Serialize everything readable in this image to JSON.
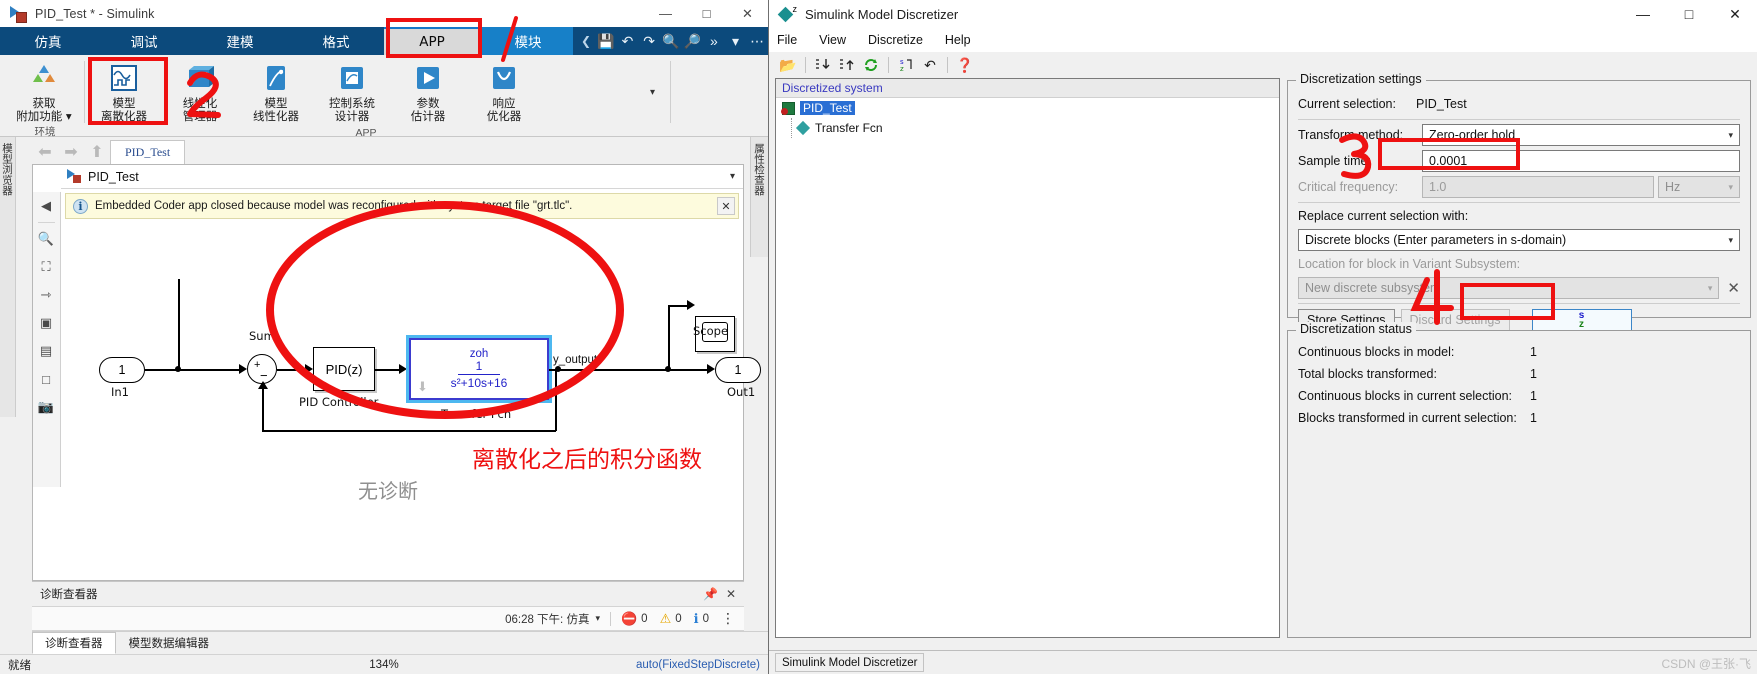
{
  "simulink": {
    "title": "PID_Test * - Simulink",
    "window_controls": {
      "minimize": "—",
      "maximize": "□",
      "close": "✕"
    },
    "ribbon_tabs": [
      {
        "label": "仿真",
        "active": false
      },
      {
        "label": "调试",
        "active": false
      },
      {
        "label": "建模",
        "active": false
      },
      {
        "label": "格式",
        "active": false
      },
      {
        "label": "APP",
        "active": true
      },
      {
        "label": "模块",
        "active": false
      }
    ],
    "quick_access": [
      "save-icon",
      "undo-icon",
      "redo-icon",
      "search-icon",
      "zoom-fit-icon",
      "more-icon",
      "chevron-down-icon",
      "ellipsis-icon"
    ],
    "ribbon_groups": [
      {
        "name": "环境",
        "items": [
          {
            "label_top": "获取",
            "label_bottom": "附加功能 ▾",
            "icon": "add-ons-icon"
          }
        ]
      },
      {
        "name": "APP",
        "items": [
          {
            "label_top": "模型",
            "label_bottom": "离散化器",
            "icon": "model-discretizer-icon"
          },
          {
            "label_top": "线性化",
            "label_bottom": "管理器",
            "icon": "linearization-manager-icon"
          },
          {
            "label_top": "模型",
            "label_bottom": "线性化器",
            "icon": "model-linearizer-icon"
          },
          {
            "label_top": "控制系统",
            "label_bottom": "设计器",
            "icon": "control-system-designer-icon"
          },
          {
            "label_top": "参数",
            "label_bottom": "估计器",
            "icon": "parameter-estimator-icon"
          },
          {
            "label_top": "响应",
            "label_bottom": "优化器",
            "icon": "response-optimizer-icon"
          }
        ]
      }
    ],
    "ribbon_expand": "▾",
    "left_vertical_tab": "模型浏览器",
    "right_vertical_tab": "属性检查器",
    "model_tab": "PID_Test",
    "nav_icons": [
      "back-arrow-icon",
      "forward-arrow-icon",
      "up-arrow-icon"
    ],
    "breadcrumb": "PID_Test",
    "notification": {
      "text": "Embedded Coder app closed because model was reconfigured with system target file \"grt.tlc\".",
      "close": "✕"
    },
    "canvas_tools": [
      "navigate-back-icon",
      "zoom-region-icon",
      "fit-to-view-icon",
      "signal-routing-icon",
      "annotation-icon",
      "scope-preview-icon",
      "area-icon",
      "camera-icon"
    ],
    "diagram": {
      "blocks": [
        {
          "name": "In1",
          "label": "In1",
          "text": "1"
        },
        {
          "name": "Sum",
          "label": "Sum",
          "plus": "+",
          "minus": "−"
        },
        {
          "name": "PID Controller",
          "label": "PID Controller",
          "text": "PID(z)"
        },
        {
          "name": "Transfer Fcn",
          "label": "Transfer Fcn",
          "zoh": "zoh",
          "num": "1",
          "den": "s²+10s+16"
        },
        {
          "name": "Scope",
          "label": "Scope"
        },
        {
          "name": "Out1",
          "label": "Out1",
          "text": "1"
        }
      ],
      "signal_label": "y_output"
    },
    "no_diagnostics": "无诊断",
    "diagnostic_panel_title": "诊断查看器",
    "diagnostic_status": {
      "timestamp": "06:28 下午: 仿真",
      "caret": "▾",
      "errors": "0",
      "warnings": "0",
      "infos": "0",
      "kebab": "⋮"
    },
    "bottom_tabs": [
      {
        "label": "诊断查看器",
        "active": true
      },
      {
        "label": "模型数据编辑器",
        "active": false
      }
    ],
    "statusbar": {
      "ready": "就绪",
      "zoom": "134%",
      "solver": "auto(FixedStepDiscrete)"
    }
  },
  "discretizer": {
    "title": "Simulink Model Discretizer",
    "window_controls": {
      "minimize": "—",
      "maximize": "□",
      "close": "✕"
    },
    "menus": [
      "File",
      "View",
      "Discretize",
      "Help"
    ],
    "toolbar_icons": [
      "open-folder-icon",
      "expand-tree-icon",
      "collapse-tree-icon",
      "refresh-icon",
      "discretize-sz-icon",
      "undo-icon",
      "help-icon"
    ],
    "tree": {
      "header": "Discretized system",
      "root": {
        "label": "PID_Test",
        "selected": true
      },
      "children": [
        {
          "label": "Transfer Fcn"
        }
      ]
    },
    "settings": {
      "legend": "Discretization settings",
      "current_selection_label": "Current selection:",
      "current_selection_value": "PID_Test",
      "transform_method_label": "Transform method:",
      "transform_method_value": "Zero-order hold",
      "sample_time_label": "Sample time:",
      "sample_time_value": "0.0001",
      "critical_frequency_label": "Critical frequency:",
      "critical_frequency_value": "1.0",
      "critical_frequency_unit": "Hz",
      "replace_label": "Replace current selection with:",
      "replace_value": "Discrete blocks (Enter parameters in s-domain)",
      "variant_label": "Location for block in Variant Subsystem:",
      "variant_value": "New discrete subsystem",
      "variant_clear": "✕",
      "store_settings": "Store Settings",
      "discard_settings": "Discard Settings",
      "apply_icon_s": "s",
      "apply_icon_z": "z"
    },
    "status": {
      "legend": "Discretization status",
      "rows": [
        {
          "key": "Continuous blocks in model:",
          "value": "1"
        },
        {
          "key": "Total blocks transformed:",
          "value": "1"
        },
        {
          "key": "Continuous blocks in current selection:",
          "value": "1"
        },
        {
          "key": "Blocks transformed in current selection:",
          "value": "1"
        }
      ]
    },
    "statusbar": "Simulink Model Discretizer"
  },
  "annotations": {
    "note_text": "离散化之后的积分函数",
    "numbers": {
      "two": "2",
      "three": "3",
      "four": "4"
    },
    "color": "#ee1111"
  },
  "watermark": "CSDN @王张·飞"
}
